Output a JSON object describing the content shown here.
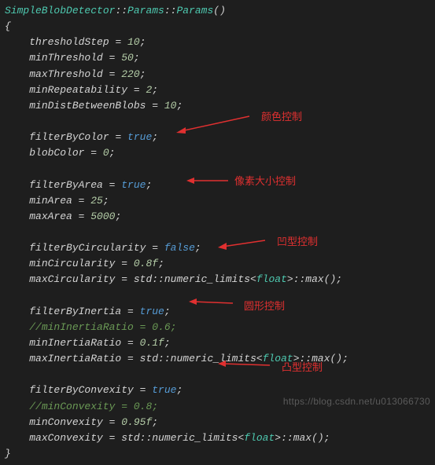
{
  "code": {
    "decl_type": "SimpleBlobDetector",
    "decl_sep1": "::",
    "decl_params1": "Params",
    "decl_sep2": "::",
    "decl_params2": "Params",
    "decl_paren": "()",
    "brace_open": "{",
    "brace_close": "}",
    "indent": "    ",
    "l1_name": "thresholdStep",
    "l1_eq": " = ",
    "l1_val": "10",
    "l1_end": ";",
    "l2_name": "minThreshold",
    "l2_val": "50",
    "l3_name": "maxThreshold",
    "l3_val": "220",
    "l4_name": "minRepeatability",
    "l4_val": "2",
    "l5_name": "minDistBetweenBlobs",
    "l5_val": "10",
    "l6_name": "filterByColor",
    "l6_val": "true",
    "l7_name": "blobColor",
    "l7_val": "0",
    "l8_name": "filterByArea",
    "l8_val": "true",
    "l9_name": "minArea",
    "l9_val": "25",
    "l10_name": "maxArea",
    "l10_val": "5000",
    "l11_name": "filterByCircularity",
    "l11_val": "false",
    "l12_name": "minCircularity",
    "l12_val": "0.8f",
    "l13_name": "maxCircularity",
    "l13_expr_a": "std::numeric_limits<",
    "l13_expr_t": "float",
    "l13_expr_b": ">::max();",
    "l14_name": "filterByInertia",
    "l14_val": "true",
    "l15_comment": "//minInertiaRatio = 0.6;",
    "l16_name": "minInertiaRatio",
    "l16_val": "0.1f",
    "l17_name": "maxInertiaRatio",
    "l18_name": "filterByConvexity",
    "l18_val": "true",
    "l19_comment": "//minConvexity = 0.8;",
    "l20_name": "minConvexity",
    "l20_val": "0.95f",
    "l21_name": "maxConvexity",
    "semi": ";",
    "eq": " = "
  },
  "annotations": {
    "a1": "颜色控制",
    "a2": "像素大小控制",
    "a3": "凹型控制",
    "a4": "圆形控制",
    "a5": "凸型控制"
  },
  "watermark": "https://blog.csdn.net/u013066730"
}
